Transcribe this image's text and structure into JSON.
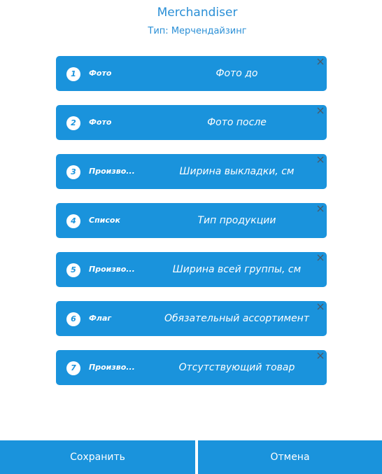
{
  "header": {
    "title": "Merchandiser",
    "subtitle": "Тип: Мерчендайзинг"
  },
  "steps": [
    {
      "number": "1",
      "type": "Фото",
      "name": "Фото до",
      "close_icon": "close-x-icon"
    },
    {
      "number": "2",
      "type": "Фото",
      "name": "Фото после",
      "close_icon": "close-x-icon"
    },
    {
      "number": "3",
      "type": "Произво...",
      "name": "Ширина выкладки, см",
      "close_icon": "close-x-icon"
    },
    {
      "number": "4",
      "type": "Список",
      "name": "Тип продукции",
      "close_icon": "close-x-icon"
    },
    {
      "number": "5",
      "type": "Произво...",
      "name": "Ширина всей группы, см",
      "close_icon": "close-x-icon"
    },
    {
      "number": "6",
      "type": "Флаг",
      "name": "Обязательный ассортимент",
      "close_icon": "close-x-icon"
    },
    {
      "number": "7",
      "type": "Произво...",
      "name": "Отсутствующий товар",
      "close_icon": "close-x-icon"
    }
  ],
  "footer": {
    "save_label": "Сохранить",
    "cancel_label": "Отмена"
  },
  "colors": {
    "accent": "#1a93dc",
    "title": "#2a8fd6",
    "close_icon": "#4a5a6a"
  }
}
